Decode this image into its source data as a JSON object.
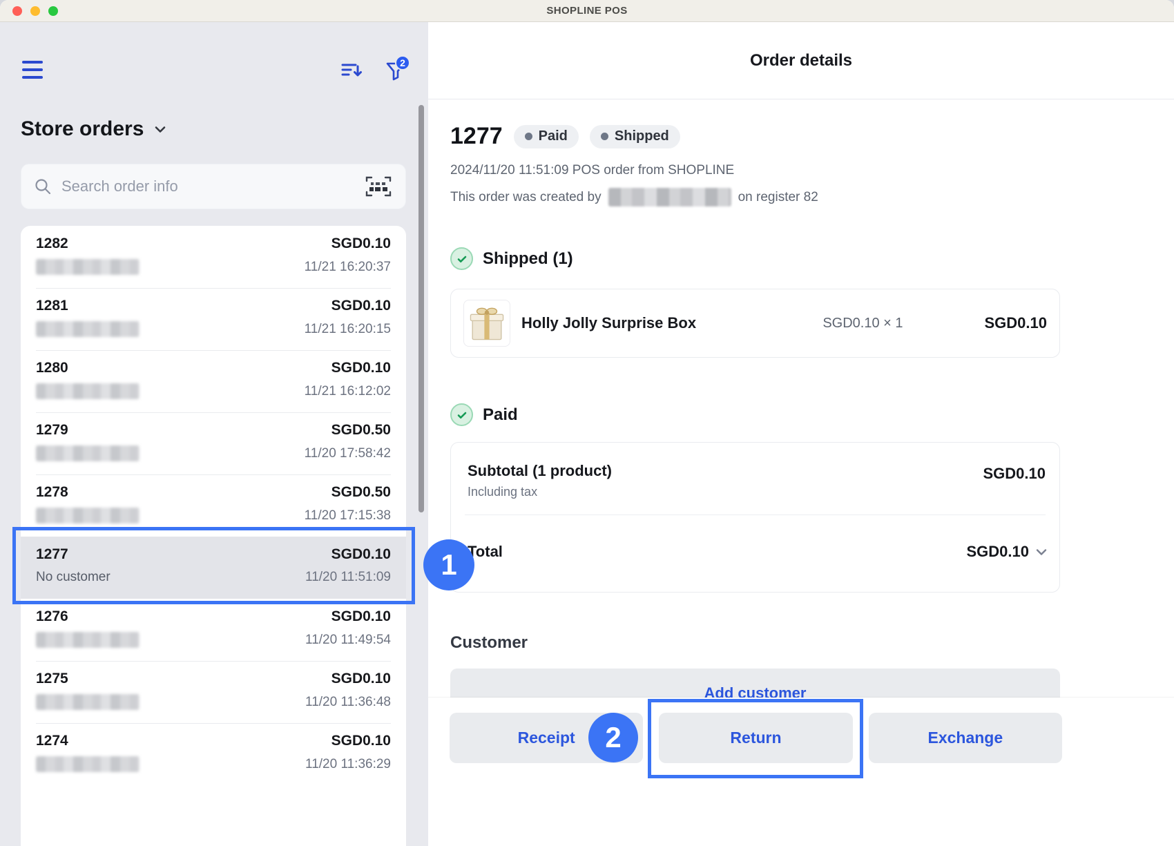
{
  "window": {
    "title": "SHOPLINE POS"
  },
  "sidebar": {
    "title": "Store orders",
    "search_placeholder": "Search order info",
    "filter_badge": "2",
    "orders": [
      {
        "id": "1282",
        "amount": "SGD0.10",
        "time": "11/21 16:20:37"
      },
      {
        "id": "1281",
        "amount": "SGD0.10",
        "time": "11/21 16:20:15"
      },
      {
        "id": "1280",
        "amount": "SGD0.10",
        "time": "11/21 16:12:02"
      },
      {
        "id": "1279",
        "amount": "SGD0.50",
        "time": "11/20 17:58:42"
      },
      {
        "id": "1278",
        "amount": "SGD0.50",
        "time": "11/20 17:15:38"
      },
      {
        "id": "1277",
        "amount": "SGD0.10",
        "customer": "No customer",
        "time": "11/20 11:51:09"
      },
      {
        "id": "1276",
        "amount": "SGD0.10",
        "time": "11/20 11:49:54"
      },
      {
        "id": "1275",
        "amount": "SGD0.10",
        "time": "11/20 11:36:48"
      },
      {
        "id": "1274",
        "amount": "SGD0.10",
        "time": "11/20 11:36:29"
      }
    ]
  },
  "details": {
    "title": "Order details",
    "order_number": "1277",
    "badges": [
      "Paid",
      "Shipped"
    ],
    "created_line": "2024/11/20 11:51:09 POS order from SHOPLINE",
    "created_by_prefix": "This order was created by",
    "created_by_suffix": "on register 82",
    "shipped_heading": "Shipped (1)",
    "product": {
      "name": "Holly Jolly Surprise Box",
      "unit_price_qty": "SGD0.10 × 1",
      "line_total": "SGD0.10"
    },
    "paid_heading": "Paid",
    "subtotal_label": "Subtotal (1 product)",
    "subtotal_note": "Including tax",
    "subtotal_value": "SGD0.10",
    "total_label": "Total",
    "total_value": "SGD0.10",
    "customer_heading": "Customer",
    "add_customer_label": "Add customer"
  },
  "actions": {
    "receipt": "Receipt",
    "return": "Return",
    "exchange": "Exchange"
  },
  "annotations": {
    "step1": "1",
    "step2": "2"
  },
  "colors": {
    "accent_blue": "#2b49cf",
    "annotation_blue": "#3b74f5",
    "success_green": "#169a55"
  }
}
